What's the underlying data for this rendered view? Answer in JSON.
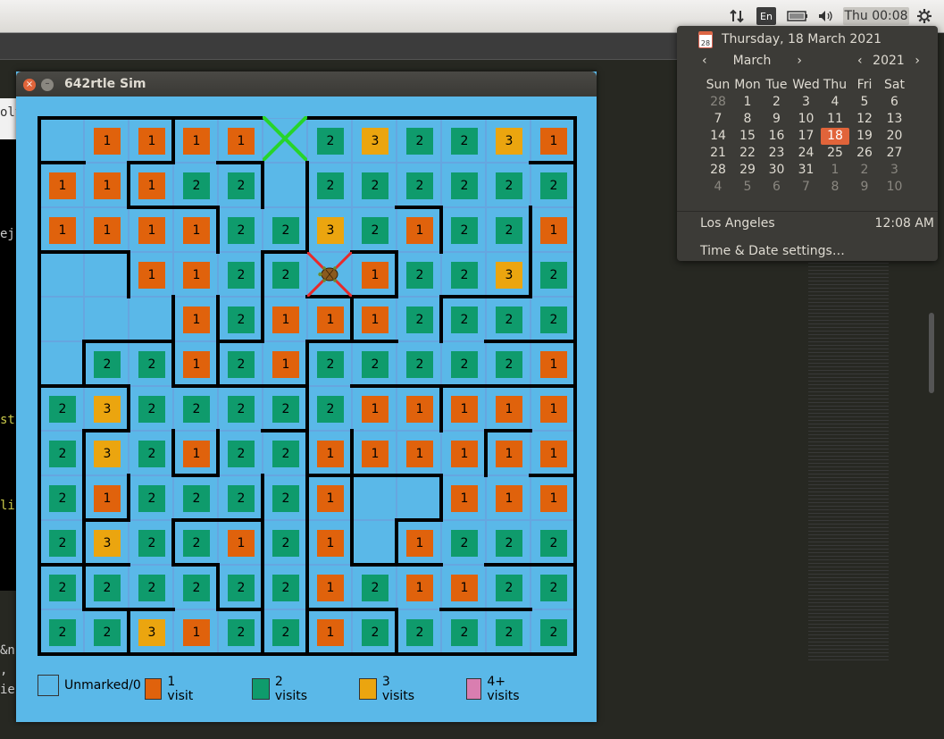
{
  "background": {
    "fragments": [
      "olv",
      "ejs",
      "stu",
      "lib",
      "&n",
      ",",
      "ie"
    ]
  },
  "top_panel": {
    "lang": "En",
    "clock": "Thu 00:08",
    "icons": [
      "network-icon",
      "battery-icon",
      "volume-icon",
      "gear-icon"
    ]
  },
  "calendar": {
    "full_date": "Thursday, 18 March 2021",
    "month": "March",
    "year": "2021",
    "weekdays": [
      "Sun",
      "Mon",
      "Tue",
      "Wed",
      "Thu",
      "Fri",
      "Sat"
    ],
    "weeks": [
      [
        "28",
        "1",
        "2",
        "3",
        "4",
        "5",
        "6"
      ],
      [
        "7",
        "8",
        "9",
        "10",
        "11",
        "12",
        "13"
      ],
      [
        "14",
        "15",
        "16",
        "17",
        "18",
        "19",
        "20"
      ],
      [
        "21",
        "22",
        "23",
        "24",
        "25",
        "26",
        "27"
      ],
      [
        "28",
        "29",
        "30",
        "31",
        "1",
        "2",
        "3"
      ],
      [
        "4",
        "5",
        "6",
        "7",
        "8",
        "9",
        "10"
      ]
    ],
    "dim": [
      [
        1,
        0,
        0,
        0,
        0,
        0,
        0
      ],
      [
        0,
        0,
        0,
        0,
        0,
        0,
        0
      ],
      [
        0,
        0,
        0,
        0,
        0,
        0,
        0
      ],
      [
        0,
        0,
        0,
        0,
        0,
        0,
        0
      ],
      [
        0,
        0,
        0,
        0,
        1,
        1,
        1
      ],
      [
        1,
        1,
        1,
        1,
        1,
        1,
        1
      ]
    ],
    "today": "18",
    "location": "Los Angeles",
    "location_time": "12:08 AM",
    "settings_label": "Time & Date settings…"
  },
  "window": {
    "title": "642rtle Sim"
  },
  "maze": {
    "rows": 12,
    "cols": 12,
    "visits": [
      [
        0,
        1,
        1,
        1,
        1,
        0,
        2,
        3,
        2,
        2,
        3,
        1
      ],
      [
        1,
        1,
        1,
        2,
        2,
        0,
        2,
        2,
        2,
        2,
        2,
        2
      ],
      [
        1,
        1,
        1,
        1,
        2,
        2,
        3,
        2,
        1,
        2,
        2,
        1
      ],
      [
        0,
        0,
        1,
        1,
        2,
        2,
        0,
        1,
        2,
        2,
        3,
        2
      ],
      [
        0,
        0,
        0,
        1,
        2,
        1,
        1,
        1,
        2,
        2,
        2,
        2
      ],
      [
        0,
        2,
        2,
        1,
        2,
        1,
        2,
        2,
        2,
        2,
        2,
        1
      ],
      [
        2,
        3,
        2,
        2,
        2,
        2,
        2,
        1,
        1,
        1,
        1,
        1
      ],
      [
        2,
        3,
        2,
        1,
        2,
        2,
        1,
        1,
        1,
        1,
        1,
        1
      ],
      [
        2,
        1,
        2,
        2,
        2,
        2,
        1,
        0,
        0,
        1,
        1,
        1
      ],
      [
        2,
        3,
        2,
        2,
        1,
        2,
        1,
        0,
        1,
        2,
        2,
        2
      ],
      [
        2,
        2,
        2,
        2,
        2,
        2,
        1,
        2,
        1,
        1,
        2,
        2
      ],
      [
        2,
        2,
        3,
        1,
        2,
        2,
        1,
        2,
        2,
        2,
        2,
        2
      ]
    ],
    "goal": {
      "row": 0,
      "col": 5
    },
    "turtle": {
      "row": 3,
      "col": 6
    },
    "colors": {
      "0": "#5ab8e8",
      "1": "#e0620c",
      "2": "#0f9b6c",
      "3": "#eba50f",
      "4": "#d97eb0"
    }
  },
  "legend": [
    {
      "label": "Unmarked/0",
      "color": "#5ab8e8"
    },
    {
      "label": "1 visit",
      "color": "#e0620c"
    },
    {
      "label": "2 visits",
      "color": "#0f9b6c"
    },
    {
      "label": "3 visits",
      "color": "#eba50f"
    },
    {
      "label": "4+ visits",
      "color": "#d97eb0"
    }
  ]
}
